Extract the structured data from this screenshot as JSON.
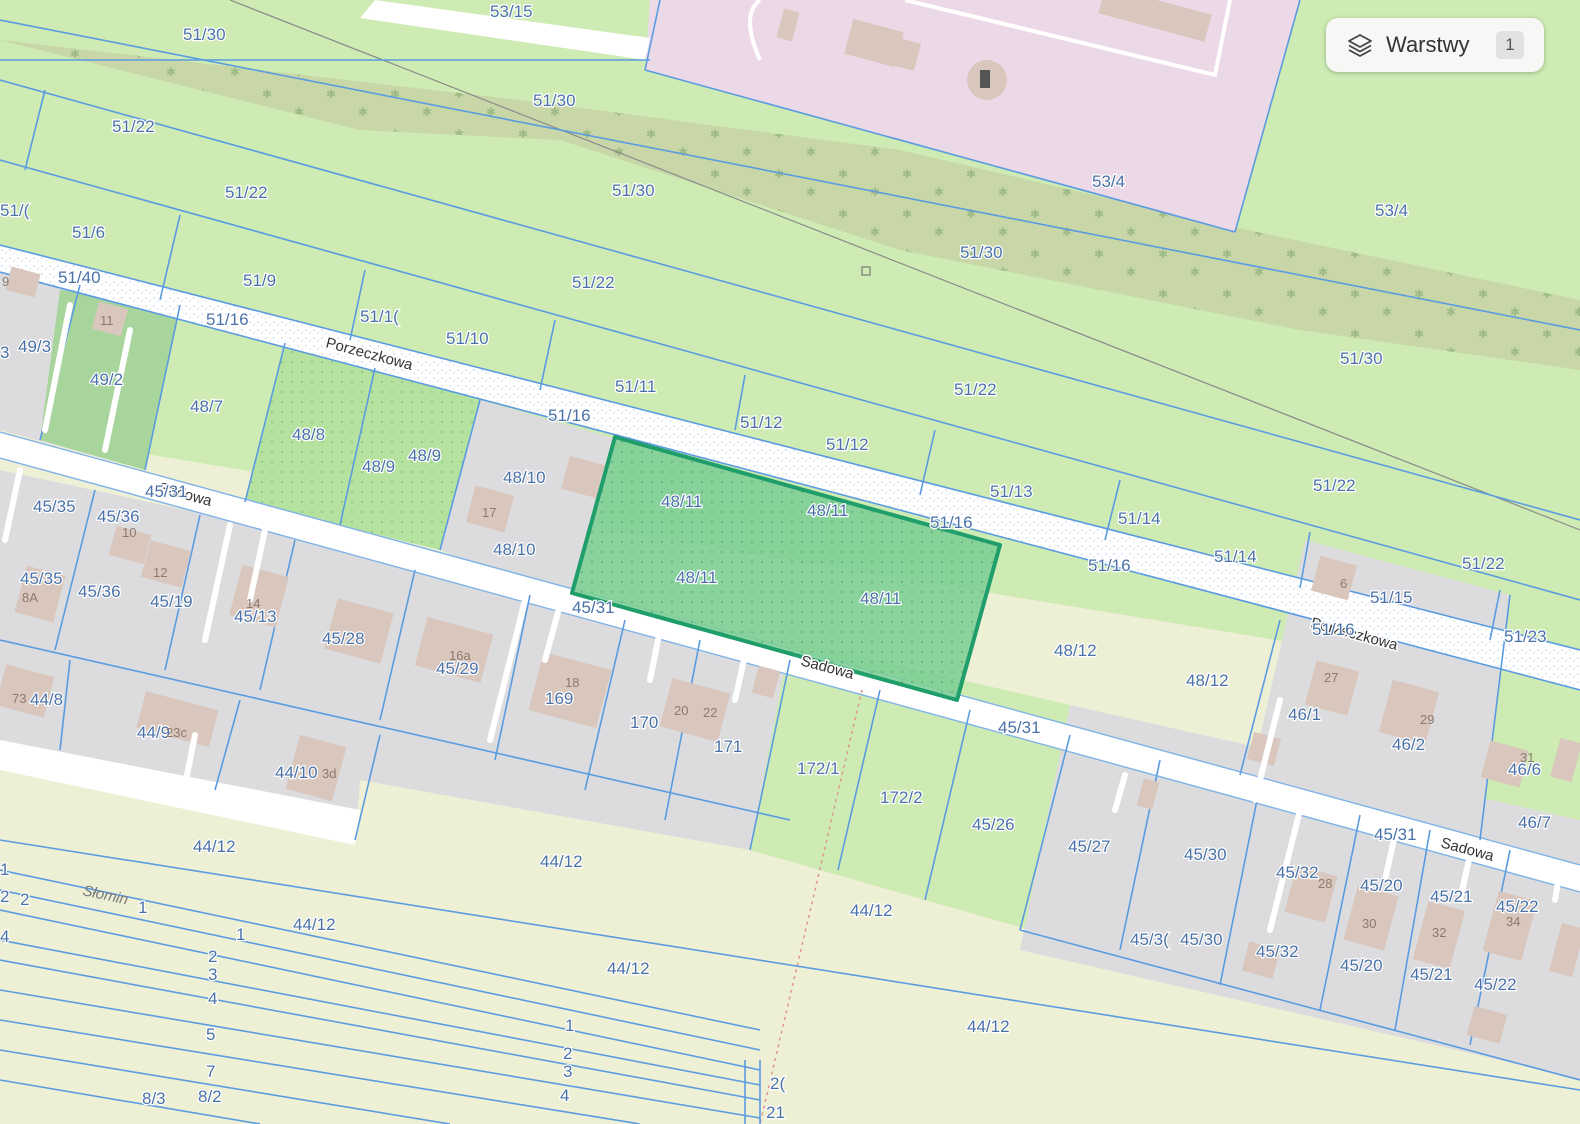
{
  "colors": {
    "parcel_outline": "#5b9be0",
    "selected_fill": "#7fcf96",
    "selected_outline": "#1f9e6b",
    "grass": "#cdebb2",
    "built": "#dcdcde",
    "industrial": "#ecd9e8",
    "farmland": "#eef1d8",
    "road": "#ffffff"
  },
  "layers_control": {
    "label": "Warstwy",
    "count": "1",
    "icon": "layers-icon"
  },
  "streets": {
    "porzeczkowa": "Porzeczkowa",
    "porzeczkowa_east": "Porzeczkowa",
    "sadowa_west": "Sadowa",
    "sadowa": "Sadowa",
    "sadowa_east": "Sadowa"
  },
  "places": {
    "slomin": "Słomin"
  },
  "selected_parcel": {
    "id": "48/11"
  },
  "parcels": {
    "p_53_15": "53/15",
    "p_51_30_a": "51/30",
    "p_51_30_b": "51/30",
    "p_51_30_c": "51/30",
    "p_51_30_d": "51/30",
    "p_51_30_e": "51/30",
    "p_53_4_a": "53/4",
    "p_53_4_b": "53/4",
    "p_51_22_a": "51/22",
    "p_51_22_b": "51/22",
    "p_51_22_c": "51/22",
    "p_51_22_d": "51/22",
    "p_51_22_e": "51/22",
    "p_51_22_f": "51/22",
    "p_51_6": "51/6",
    "p_51_edge": "51/(",
    "p_51_40": "51/40",
    "p_51_9": "51/9",
    "p_51_16_a": "51/16",
    "p_51_16_b": "51/16",
    "p_51_16_c": "51/16",
    "p_51_16_d": "51/16",
    "p_51_16_e": "51/16",
    "p_51_10_a": "51/1(",
    "p_51_10_b": "51/10",
    "p_51_11": "51/11",
    "p_51_12_a": "51/12",
    "p_51_12_b": "51/12",
    "p_51_13": "51/13",
    "p_51_14_a": "51/14",
    "p_51_14_b": "51/14",
    "p_51_15": "51/15",
    "p_51_23": "51/23",
    "p_49_3": "49/3",
    "p_49_3_edge": "3",
    "p_49_2": "49/2",
    "p_48_7": "48/7",
    "p_48_8": "48/8",
    "p_48_9_a": "48/9",
    "p_48_9_b": "48/9",
    "p_48_10_a": "48/10",
    "p_48_10_b": "48/10",
    "p_48_11_a": "48/11",
    "p_48_11_b": "48/11",
    "p_48_11_c": "48/11",
    "p_48_11_d": "48/11",
    "p_48_12_a": "48/12",
    "p_48_12_b": "48/12",
    "p_45_31_a": "45/31",
    "p_45_31_b": "45/31",
    "p_45_31_c": "45/31",
    "p_45_31_d": "45/31",
    "p_45_35_a": "45/35",
    "p_45_35_b": "45/35",
    "p_45_36_a": "45/36",
    "p_45_36_b": "45/36",
    "p_45_19": "45/19",
    "p_45_13": "45/13",
    "p_45_28": "45/28",
    "p_45_29": "45/29",
    "p_169": "169",
    "p_170": "170",
    "p_171": "171",
    "p_172_1": "172/1",
    "p_172_2": "172/2",
    "p_45_26": "45/26",
    "p_45_27": "45/27",
    "p_45_30_a": "45/30",
    "p_45_30_b": "45/3(",
    "p_45_30_c": "45/30",
    "p_45_32_a": "45/32",
    "p_45_32_b": "45/32",
    "p_45_20_a": "45/20",
    "p_45_20_b": "45/20",
    "p_45_21_a": "45/21",
    "p_45_21_b": "45/21",
    "p_45_22_a": "45/22",
    "p_45_22_b": "45/22",
    "p_46_1": "46/1",
    "p_46_2": "46/2",
    "p_46_6": "46/6",
    "p_46_7": "46/7",
    "p_44_8": "44/8",
    "p_44_9": "44/9",
    "p_44_10": "44/10",
    "p_44_12_a": "44/12",
    "p_44_12_b": "44/12",
    "p_44_12_c": "44/12",
    "p_44_12_d": "44/12",
    "p_44_12_e": "44/12",
    "p_44_12_f": "44/12",
    "s_1_a": "1",
    "s_1_b": "1",
    "s_1_c": "1",
    "s_1_d": "1",
    "s_2_a": "2",
    "s_2_b": "2",
    "s_2_c": "2",
    "s_2_d": "2",
    "s_3_a": "3",
    "s_3_b": "3",
    "s_4_a": "4",
    "s_4_b": "4",
    "s_4_c": "4",
    "s_5": "5",
    "s_7": "7",
    "p_8_3": "8/3",
    "p_8_2": "8/2",
    "p_20": "2(",
    "p_21": "21"
  },
  "house_numbers": {
    "h_9": "9",
    "h_11": "11",
    "h_10": "10",
    "h_12": "12",
    "h_8a": "8A",
    "h_14": "14",
    "h_16a": "16a",
    "h_17": "17",
    "h_18": "18",
    "h_20": "20",
    "h_22": "22",
    "h_73": "73",
    "h_23c": "23c",
    "h_23d": "3d",
    "h_6": "6",
    "h_27": "27",
    "h_29": "29",
    "h_31": "31",
    "h_28": "28",
    "h_30": "30",
    "h_32": "32",
    "h_34": "34"
  }
}
